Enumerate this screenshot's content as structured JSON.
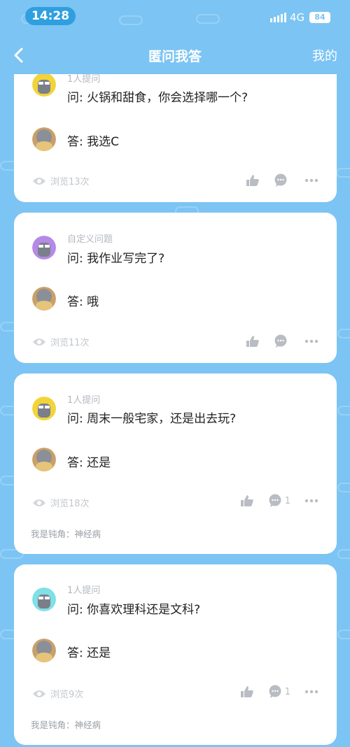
{
  "status_bar": {
    "time": "14:28",
    "network": "4G",
    "battery": "84"
  },
  "nav": {
    "title": "匿问我答",
    "right_label": "我的"
  },
  "cards": [
    {
      "asker_label": "1人提问",
      "question": "问: 火锅和甜食，你会选择哪一个?",
      "answer": "答: 我选C",
      "views": "浏览13次",
      "comment_count": "",
      "signature": "",
      "avatar_color": "#f2d43a"
    },
    {
      "asker_label": "自定义问题",
      "question": "问: 我作业写完了?",
      "answer": "答: 哦",
      "views": "浏览11次",
      "comment_count": "",
      "signature": "",
      "avatar_color": "#b58ae6"
    },
    {
      "asker_label": "1人提问",
      "question": "问: 周末一般宅家，还是出去玩?",
      "answer": "答: 还是",
      "views": "浏览18次",
      "comment_count": "1",
      "signature": "我是钝角：神经病",
      "avatar_color": "#f2d43a"
    },
    {
      "asker_label": "1人提问",
      "question": "问: 你喜欢理科还是文科?",
      "answer": "答: 还是",
      "views": "浏览9次",
      "comment_count": "1",
      "signature": "我是钝角：神经病",
      "avatar_color": "#7fe0e6"
    }
  ],
  "colors": {
    "background": "#7cc4f3",
    "card": "#ffffff",
    "icon_gray": "#b9bdc3"
  },
  "icons": [
    "back-icon",
    "eye-icon",
    "thumbs-up-icon",
    "comment-icon",
    "more-icon"
  ]
}
